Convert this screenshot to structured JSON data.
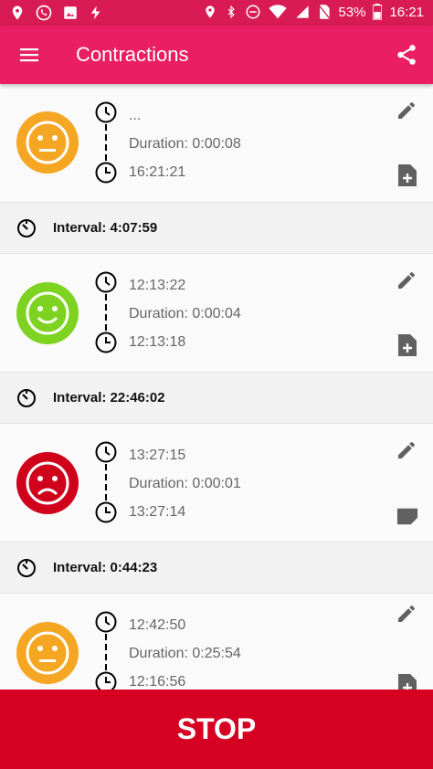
{
  "status_bar": {
    "battery": "53%",
    "time": "16:21"
  },
  "app_bar": {
    "title": "Contractions"
  },
  "contractions": [
    {
      "mood": "neutral",
      "color": "#f5a623",
      "end": "...",
      "duration": "Duration: 0:00:08",
      "start": "16:21:21",
      "note": "add"
    },
    {
      "mood": "happy",
      "color": "#7ed321",
      "end": "12:13:22",
      "duration": "Duration: 0:00:04",
      "start": "12:13:18",
      "note": "add"
    },
    {
      "mood": "sad",
      "color": "#d0021b",
      "end": "13:27:15",
      "duration": "Duration: 0:00:01",
      "start": "13:27:14",
      "note": "filled"
    },
    {
      "mood": "neutral",
      "color": "#f5a623",
      "end": "12:42:50",
      "duration": "Duration: 0:25:54",
      "start": "12:16:56",
      "note": "add"
    }
  ],
  "intervals": [
    "Interval: 4:07:59",
    "Interval: 22:46:02",
    "Interval: 0:44:23"
  ],
  "stop_button": {
    "label": "STOP"
  },
  "colors": {
    "primary": "#e91e63",
    "status_bar": "#d81b55",
    "stop": "#d50022"
  }
}
